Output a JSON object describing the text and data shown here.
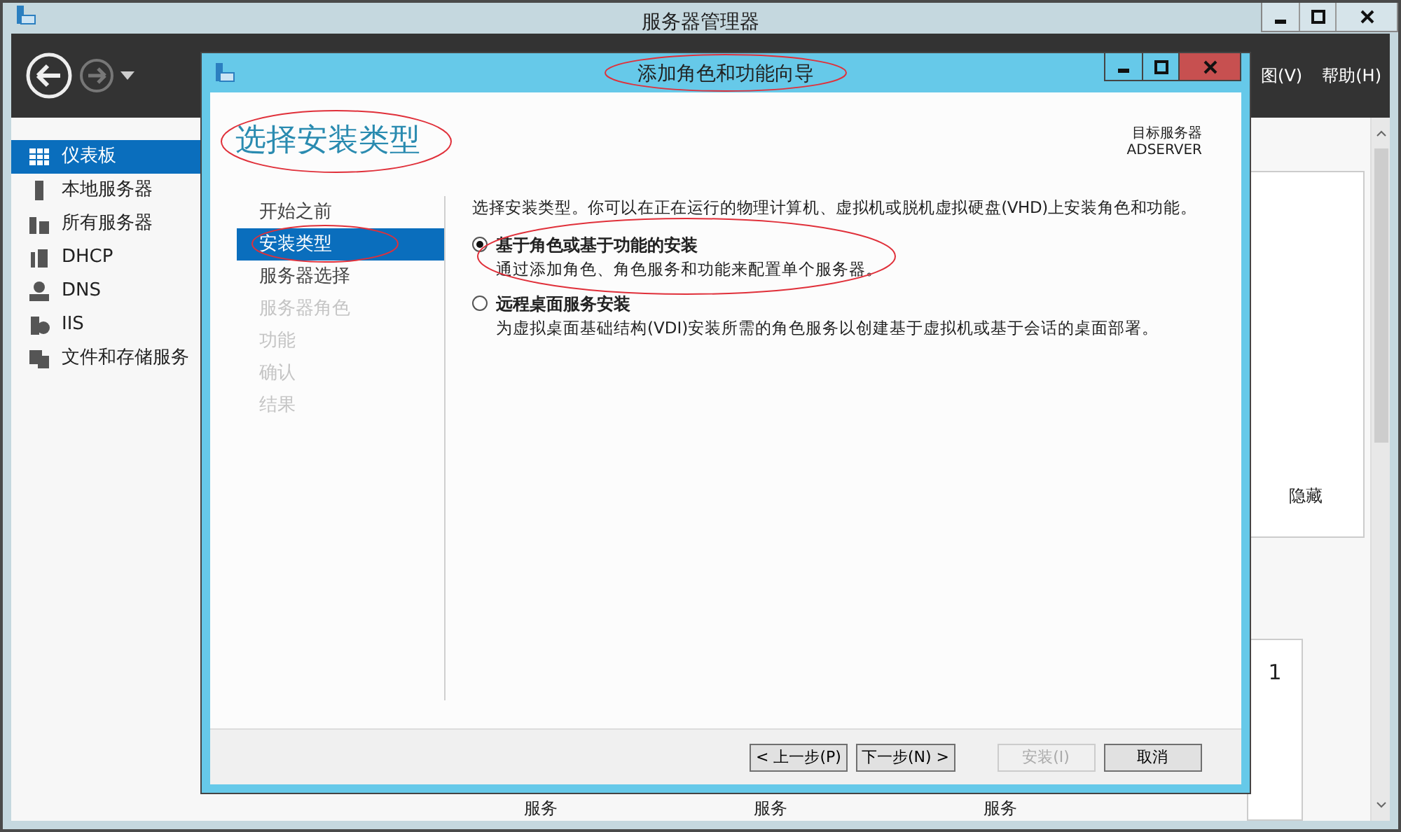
{
  "app": {
    "title": "服务器管理器",
    "menu": [
      {
        "label": "图(V)"
      },
      {
        "label": "帮助(H)"
      }
    ],
    "sidebar": [
      {
        "label": "仪表板",
        "selected": true
      },
      {
        "label": "本地服务器",
        "selected": false
      },
      {
        "label": "所有服务器",
        "selected": false
      },
      {
        "label": "DHCP",
        "selected": false
      },
      {
        "label": "DNS",
        "selected": false
      },
      {
        "label": "IIS",
        "selected": false
      },
      {
        "label": "文件和存储服务",
        "selected": false
      }
    ],
    "tiles": [
      {
        "label": "隐藏"
      },
      {
        "label": "1"
      }
    ],
    "bottom_cells": [
      "服务",
      "服务",
      "服务"
    ]
  },
  "dialog": {
    "title": "添加角色和功能向导",
    "heading": "选择安装类型",
    "target_label": "目标服务器",
    "target_server": "ADSERVER",
    "steps": [
      {
        "label": "开始之前",
        "selected": false,
        "disabled": false
      },
      {
        "label": "安装类型",
        "selected": true,
        "disabled": false
      },
      {
        "label": "服务器选择",
        "selected": false,
        "disabled": false
      },
      {
        "label": "服务器角色",
        "selected": false,
        "disabled": true
      },
      {
        "label": "功能",
        "selected": false,
        "disabled": true
      },
      {
        "label": "确认",
        "selected": false,
        "disabled": true
      },
      {
        "label": "结果",
        "selected": false,
        "disabled": true
      }
    ],
    "intro": "选择安装类型。你可以在正在运行的物理计算机、虚拟机或脱机虚拟硬盘(VHD)上安装角色和功能。",
    "options": [
      {
        "title": "基于角色或基于功能的安装",
        "description": "通过添加角色、角色服务和功能来配置单个服务器。",
        "selected": true
      },
      {
        "title": "远程桌面服务安装",
        "description": "为虚拟桌面基础结构(VDI)安装所需的角色服务以创建基于虚拟机或基于会话的桌面部署。",
        "selected": false
      }
    ],
    "buttons": [
      {
        "label": "< 上一步(P)",
        "disabled": false
      },
      {
        "label": "下一步(N) >",
        "disabled": false
      },
      {
        "label": "安装(I)",
        "disabled": true
      },
      {
        "label": "取消",
        "disabled": false
      }
    ]
  },
  "annotation_marks": [
    {
      "kind": "ellipse"
    },
    {
      "kind": "ellipse"
    },
    {
      "kind": "ellipse"
    },
    {
      "kind": "ellipse"
    }
  ]
}
